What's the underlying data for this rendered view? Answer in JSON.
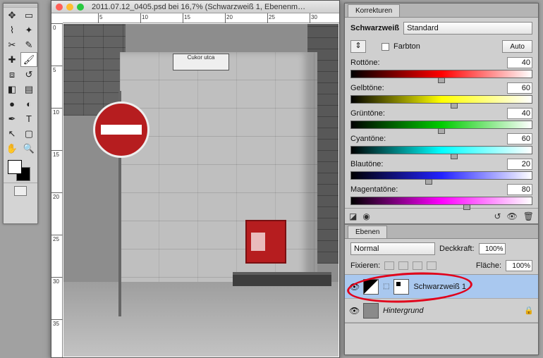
{
  "doc": {
    "title": "2011.07.12_0405.psd bei 16,7% (Schwarzweiß 1, Ebenenm…",
    "streetsign_l1": "Cukor utca"
  },
  "corrections": {
    "tab": "Korrekturen",
    "adjustment": "Schwarzweiß",
    "preset": "Standard",
    "tint_label": "Farbton",
    "auto": "Auto",
    "tones": [
      {
        "label": "Rottöne:",
        "value": "40",
        "cls": "gr-red",
        "pos": 50
      },
      {
        "label": "Gelbtöne:",
        "value": "60",
        "cls": "gr-yel",
        "pos": 57
      },
      {
        "label": "Grüntöne:",
        "value": "40",
        "cls": "gr-grn",
        "pos": 50
      },
      {
        "label": "Cyantöne:",
        "value": "60",
        "cls": "gr-cyn",
        "pos": 57
      },
      {
        "label": "Blautöne:",
        "value": "20",
        "cls": "gr-blu",
        "pos": 43
      },
      {
        "label": "Magentatöne:",
        "value": "80",
        "cls": "gr-mag",
        "pos": 64
      }
    ]
  },
  "layers": {
    "tab": "Ebenen",
    "blend": "Normal",
    "opacity_label": "Deckkraft:",
    "opacity": "100%",
    "lock_label": "Fixieren:",
    "fill_label": "Fläche:",
    "fill": "100%",
    "items": [
      {
        "name": "Schwarzweiß 1",
        "sel": true,
        "adj": true
      },
      {
        "name": "Hintergrund",
        "sel": false,
        "adj": false,
        "locked": true,
        "italic": true
      }
    ]
  }
}
